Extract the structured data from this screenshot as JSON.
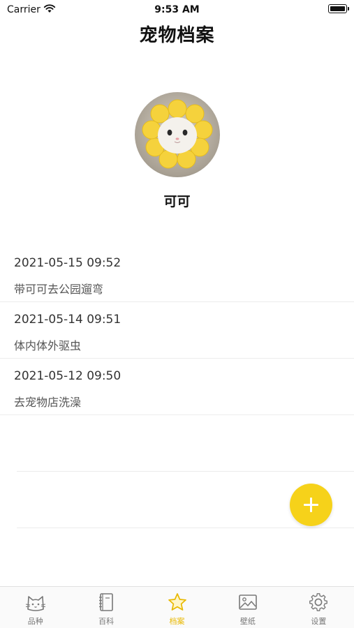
{
  "status_bar": {
    "carrier": "Carrier",
    "time": "9:53 AM"
  },
  "header": {
    "title": "宠物档案"
  },
  "pet": {
    "name": "可可"
  },
  "records": [
    {
      "date": "2021-05-15 09:52",
      "note": "带可可去公园遛弯"
    },
    {
      "date": "2021-05-14 09:51",
      "note": "体内体外驱虫"
    },
    {
      "date": "2021-05-12 09:50",
      "note": "去宠物店洗澡"
    }
  ],
  "tabs": [
    {
      "label": "品种",
      "icon": "cat-face-icon"
    },
    {
      "label": "百科",
      "icon": "notebook-icon"
    },
    {
      "label": "档案",
      "icon": "star-icon",
      "active": true
    },
    {
      "label": "壁纸",
      "icon": "image-icon"
    },
    {
      "label": "设置",
      "icon": "gear-icon"
    }
  ],
  "colors": {
    "accent": "#f6d21a",
    "active_tab": "#e8b800",
    "inactive_tab": "#777777"
  }
}
